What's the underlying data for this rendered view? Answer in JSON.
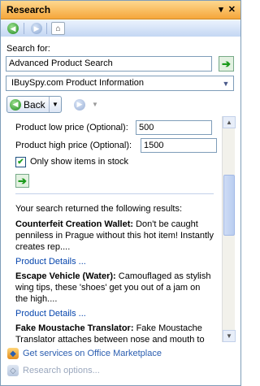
{
  "titlebar": {
    "title": "Research",
    "menu_glyph": "▾",
    "close_glyph": "✕"
  },
  "nav": {
    "back_glyph": "◀",
    "forward_glyph": "▶",
    "home_glyph": "⌂"
  },
  "search": {
    "label": "Search for:",
    "value": "Advanced Product Search",
    "go_glyph": "➔"
  },
  "source": {
    "selected": "IBuySpy.com Product Information",
    "arrow_glyph": "▼"
  },
  "history": {
    "back_label": "Back",
    "back_glyph": "◀",
    "dropdown_glyph": "▼",
    "forward_glyph": "▶"
  },
  "form": {
    "low_price_label": "Product low price (Optional):",
    "low_price_value": "500",
    "high_price_label": "Product high price (Optional):",
    "high_price_value": "1500",
    "in_stock_label": "Only show items in stock",
    "in_stock_checked": true,
    "check_glyph": "✔",
    "go_glyph": "➔"
  },
  "results": {
    "intro": "Your search returned the following results:",
    "items": [
      {
        "name": "Counterfeit Creation Wallet:",
        "desc": "Don't be caught penniless in Prague without this hot item! Instantly creates rep....",
        "link": "Product Details ..."
      },
      {
        "name": "Escape Vehicle (Water):",
        "desc": "Camouflaged as stylish wing tips, these 'shoes' get you out of a jam on the high....",
        "link": "Product Details ..."
      },
      {
        "name": "Fake Moustache Translator:",
        "desc": "Fake Moustache Translator attaches between nose and mouth to"
      }
    ]
  },
  "scroll": {
    "up_glyph": "▲",
    "down_glyph": "▼"
  },
  "footer": {
    "marketplace_label": "Get services on Office Marketplace",
    "options_label": "Research options...",
    "marketplace_glyph": "◆",
    "options_glyph": "◇"
  }
}
